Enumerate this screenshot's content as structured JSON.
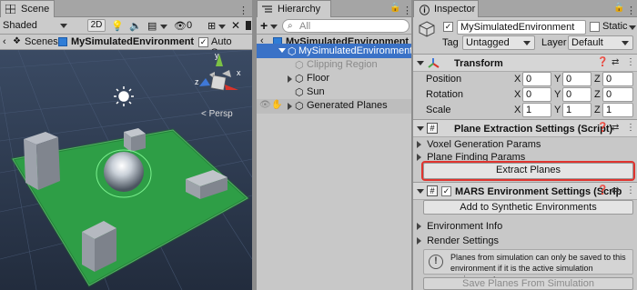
{
  "scene": {
    "tab_label": "Scene",
    "shading_mode": "Shaded",
    "toolbar_2d": "2D",
    "toolbar_zero": "0",
    "breadcrumb_root": "Scenes",
    "breadcrumb_current": "MySimulatedEnvironment",
    "autosave_label": "Auto Save",
    "autosave_checked": true,
    "persp_label": "< Persp",
    "gizmo_x": "x",
    "gizmo_y": "y",
    "gizmo_z": "z"
  },
  "hierarchy": {
    "tab_label": "Hierarchy",
    "add_label": "+",
    "search_placeholder": "All",
    "scene_root": "MySimulatedEnvironment",
    "items": [
      {
        "label": "MySimulatedEnvironment",
        "selected": true,
        "expanded": true
      },
      {
        "label": "Clipping Region",
        "dimmed": true
      },
      {
        "label": "Floor",
        "expandable": true
      },
      {
        "label": "Sun"
      },
      {
        "label": "Generated Planes",
        "expandable": true
      }
    ]
  },
  "inspector": {
    "tab_label": "Inspector",
    "object_name": "MySimulatedEnvironment",
    "active_checked": true,
    "static_label": "Static",
    "tag_label": "Tag",
    "tag_value": "Untagged",
    "layer_label": "Layer",
    "layer_value": "Default",
    "transform": {
      "title": "Transform",
      "rows": [
        {
          "label": "Position",
          "x": "0",
          "y": "0",
          "z": "0"
        },
        {
          "label": "Rotation",
          "x": "0",
          "y": "0",
          "z": "0"
        },
        {
          "label": "Scale",
          "x": "1",
          "y": "1",
          "z": "1"
        }
      ],
      "axis_x": "X",
      "axis_y": "Y",
      "axis_z": "Z"
    },
    "plane_extraction": {
      "title": "Plane Extraction Settings (Script)",
      "voxel_label": "Voxel Generation Params",
      "plane_label": "Plane Finding Params",
      "extract_button": "Extract Planes"
    },
    "mars_env": {
      "title": "MARS Environment Settings (Scrip",
      "add_button": "Add to Synthetic Environments",
      "env_info": "Environment Info",
      "render_settings": "Render Settings",
      "help_text": "Planes from simulation can only be saved to this environment if it is the active simulation environment.",
      "save_button": "Save Planes From Simulation"
    }
  },
  "colors": {
    "selection": "#3a72c7",
    "highlight_border": "#e0342f",
    "floor_green": "#2ea44a",
    "scene_sky": "#2f3d56"
  }
}
